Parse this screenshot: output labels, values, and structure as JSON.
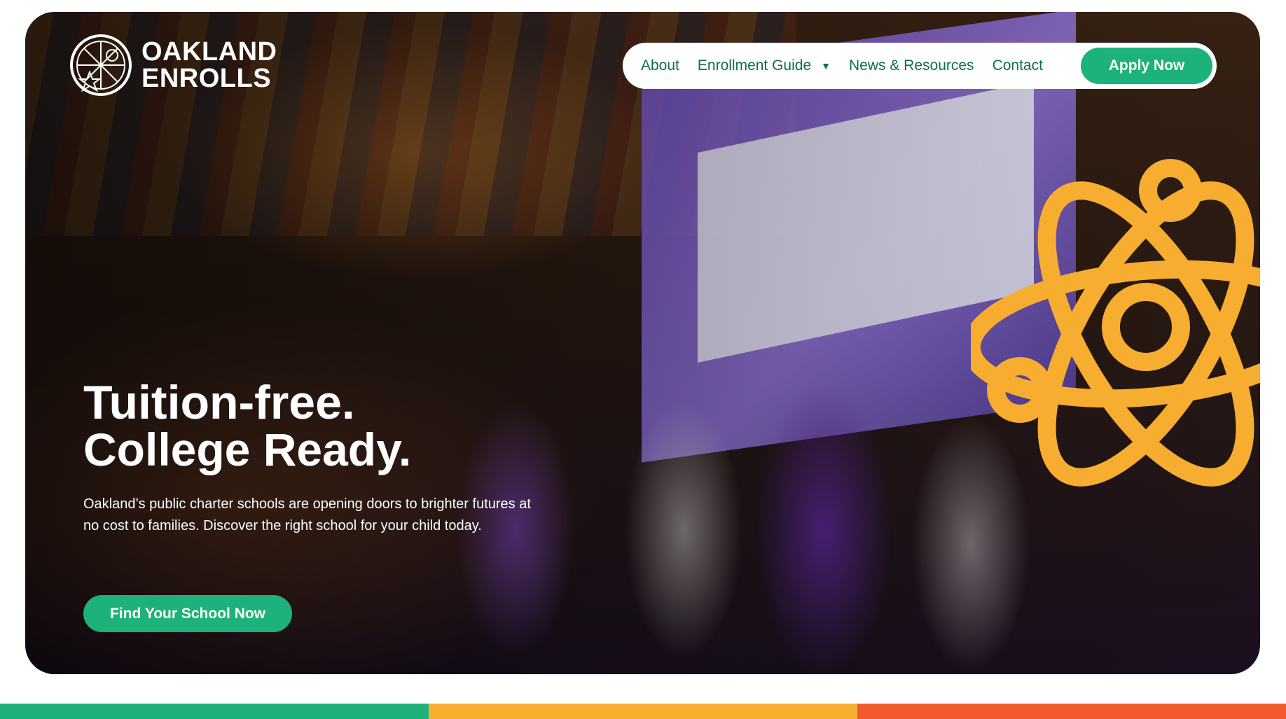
{
  "brand": {
    "line1": "OAKLAND",
    "line2": "ENROLLS",
    "logo_icon": "seal-emblem-icon"
  },
  "nav": {
    "items": [
      {
        "label": "About"
      },
      {
        "label": "Enrollment Guide",
        "has_dropdown": true,
        "icon": "caret-down-icon"
      },
      {
        "label": "News & Resources"
      },
      {
        "label": "Contact"
      }
    ],
    "cta_label": "Apply Now"
  },
  "hero": {
    "headline_bold": "Tuition-free.",
    "headline_light": "College Ready.",
    "body": "Oakland’s public charter schools are opening doors to brighter futures at no cost to families. Discover the right school for your child today.",
    "cta_label": "Find Your School Now",
    "decoration_icon": "atom-icon"
  },
  "colors": {
    "primary_green": "#1db27b",
    "nav_text": "#0f6e52",
    "accent_yellow": "#f7ad2f",
    "accent_orange": "#f25a2e"
  }
}
